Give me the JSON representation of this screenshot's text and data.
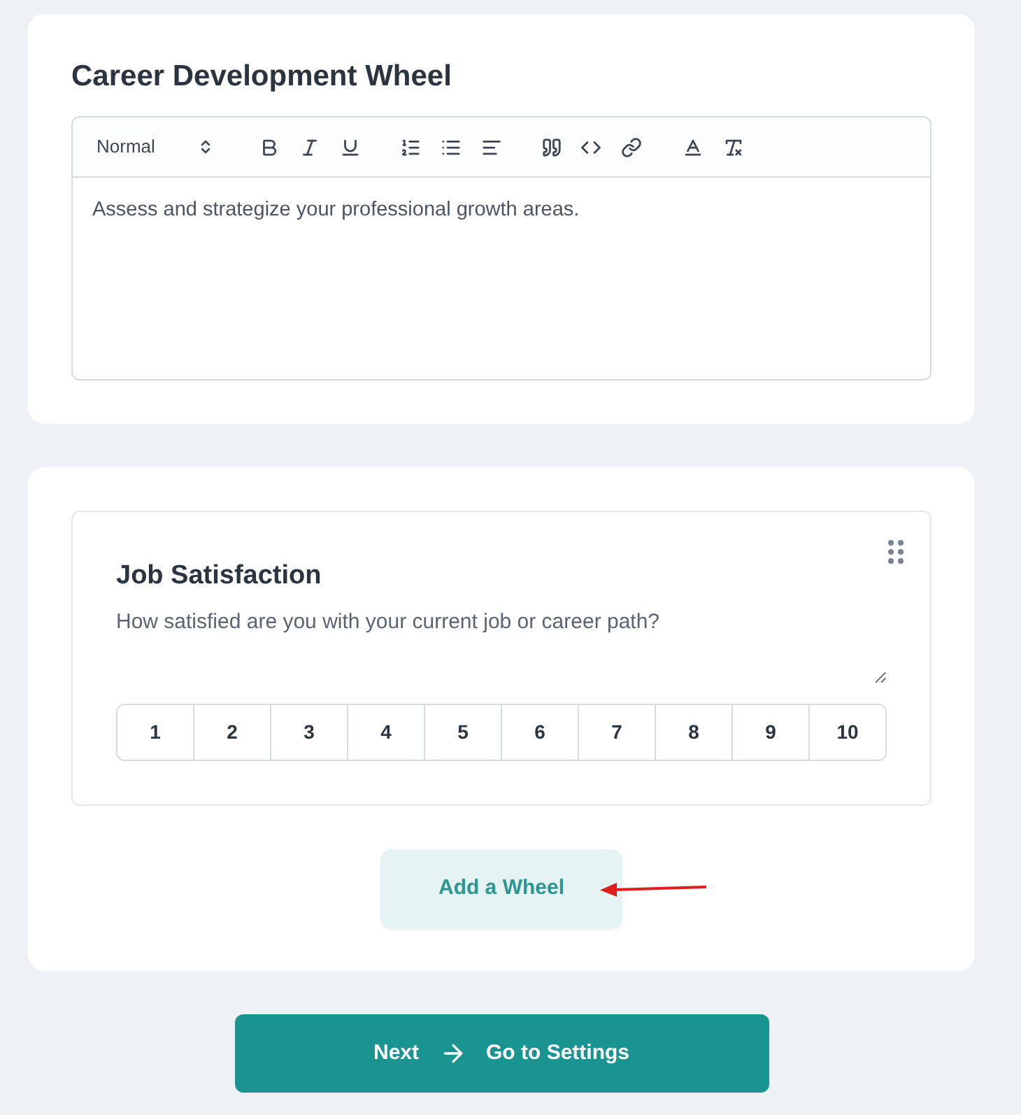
{
  "editor_card": {
    "title": "Career Development Wheel",
    "format_select": "Normal",
    "content": "Assess and strategize your professional growth areas."
  },
  "question_card": {
    "title": "Job Satisfaction",
    "question": "How satisfied are you with your current job or career path?",
    "scale": [
      {
        "label": "1",
        "selected": false
      },
      {
        "label": "2",
        "selected": false
      },
      {
        "label": "3",
        "selected": false
      },
      {
        "label": "4",
        "selected": false
      },
      {
        "label": "5",
        "selected": false
      },
      {
        "label": "6",
        "selected": false
      },
      {
        "label": "7",
        "selected": false
      },
      {
        "label": "8",
        "selected": false
      },
      {
        "label": "9",
        "selected": false
      },
      {
        "label": "10",
        "selected": false
      }
    ]
  },
  "add_button": "Add a Wheel",
  "next_button": {
    "label": "Next",
    "target": "Go to Settings"
  }
}
